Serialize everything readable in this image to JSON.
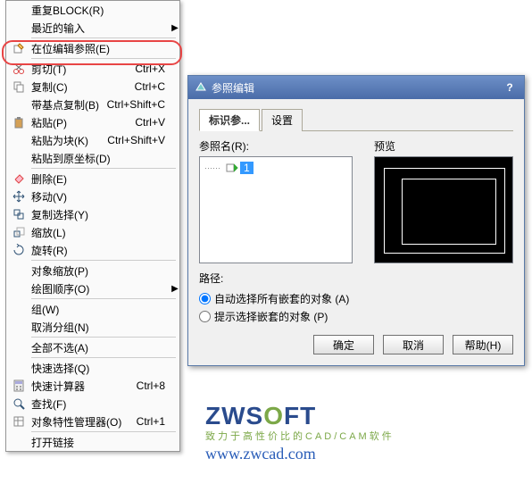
{
  "menu": {
    "items": [
      {
        "label": "重复BLOCK(R)",
        "shortcut": "",
        "arrow": false,
        "icon": ""
      },
      {
        "label": "最近的输入",
        "shortcut": "",
        "arrow": true,
        "icon": ""
      },
      {
        "sep": true
      },
      {
        "label": "在位编辑参照(E)",
        "shortcut": "",
        "arrow": false,
        "icon": "edit-ref"
      },
      {
        "sep": true
      },
      {
        "label": "剪切(T)",
        "shortcut": "Ctrl+X",
        "arrow": false,
        "icon": "cut"
      },
      {
        "label": "复制(C)",
        "shortcut": "Ctrl+C",
        "arrow": false,
        "icon": "copy"
      },
      {
        "label": "带基点复制(B)",
        "shortcut": "Ctrl+Shift+C",
        "arrow": false,
        "icon": ""
      },
      {
        "label": "粘贴(P)",
        "shortcut": "Ctrl+V",
        "arrow": false,
        "icon": "paste"
      },
      {
        "label": "粘贴为块(K)",
        "shortcut": "Ctrl+Shift+V",
        "arrow": false,
        "icon": ""
      },
      {
        "label": "粘贴到原坐标(D)",
        "shortcut": "",
        "arrow": false,
        "icon": ""
      },
      {
        "sep": true
      },
      {
        "label": "删除(E)",
        "shortcut": "",
        "arrow": false,
        "icon": "erase"
      },
      {
        "label": "移动(V)",
        "shortcut": "",
        "arrow": false,
        "icon": "move"
      },
      {
        "label": "复制选择(Y)",
        "shortcut": "",
        "arrow": false,
        "icon": "copysel"
      },
      {
        "label": "缩放(L)",
        "shortcut": "",
        "arrow": false,
        "icon": "scale"
      },
      {
        "label": "旋转(R)",
        "shortcut": "",
        "arrow": false,
        "icon": "rotate"
      },
      {
        "sep": true
      },
      {
        "label": "对象缩放(P)",
        "shortcut": "",
        "arrow": false,
        "icon": ""
      },
      {
        "label": "绘图顺序(O)",
        "shortcut": "",
        "arrow": true,
        "icon": ""
      },
      {
        "sep": true
      },
      {
        "label": "组(W)",
        "shortcut": "",
        "arrow": false,
        "icon": ""
      },
      {
        "label": "取消分组(N)",
        "shortcut": "",
        "arrow": false,
        "icon": ""
      },
      {
        "sep": true
      },
      {
        "label": "全部不选(A)",
        "shortcut": "",
        "arrow": false,
        "icon": ""
      },
      {
        "sep": true
      },
      {
        "label": "快速选择(Q)",
        "shortcut": "",
        "arrow": false,
        "icon": ""
      },
      {
        "label": "快速计算器",
        "shortcut": "Ctrl+8",
        "arrow": false,
        "icon": "calc"
      },
      {
        "label": "查找(F)",
        "shortcut": "",
        "arrow": false,
        "icon": "find"
      },
      {
        "label": "对象特性管理器(O)",
        "shortcut": "Ctrl+1",
        "arrow": false,
        "icon": "props"
      },
      {
        "sep": true
      },
      {
        "label": "打开链接",
        "shortcut": "",
        "arrow": false,
        "icon": ""
      }
    ]
  },
  "dialog": {
    "title": "参照编辑",
    "tabs": [
      "标识参...",
      "设置"
    ],
    "refname_label": "参照名(R):",
    "preview_label": "预览",
    "tree_item": "1",
    "path_label": "路径:",
    "radio1": "自动选择所有嵌套的对象 (A)",
    "radio2": "提示选择嵌套的对象 (P)",
    "buttons": {
      "ok": "确定",
      "cancel": "取消",
      "help": "帮助(H)"
    }
  },
  "logo": {
    "main1": "ZWS",
    "main2": "O",
    "main3": "FT",
    "sub": "致力于高性价比的CAD/CAM软件",
    "url": "www.zwcad.com"
  }
}
